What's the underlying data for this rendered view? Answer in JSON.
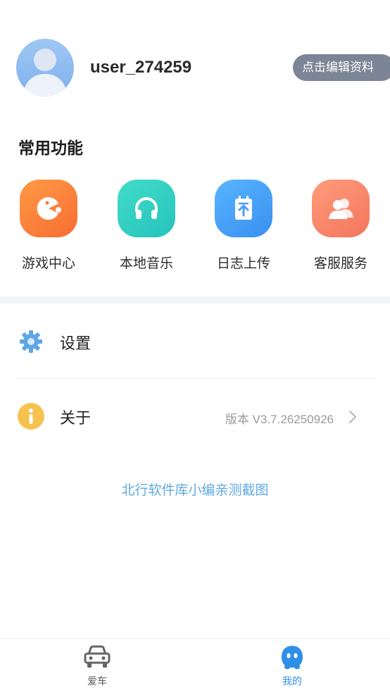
{
  "profile": {
    "username": "user_274259",
    "edit_label": "点击编辑资料"
  },
  "functions": {
    "title": "常用功能",
    "items": [
      {
        "label": "游戏中心",
        "icon": "game-icon",
        "color": "#f7783a"
      },
      {
        "label": "本地音乐",
        "icon": "headphones-icon",
        "color": "#2fcbc0"
      },
      {
        "label": "日志上传",
        "icon": "upload-icon",
        "color": "#4a9ff5"
      },
      {
        "label": "客服服务",
        "icon": "users-icon",
        "color": "#f7826a"
      }
    ]
  },
  "menu": {
    "settings_label": "设置",
    "about_label": "关于",
    "version": "版本 V3.7.26250926"
  },
  "watermark": "北行软件库小编亲测截图",
  "tabbar": {
    "car_label": "爱车",
    "mine_label": "我的",
    "active_color": "#2e8ee8"
  }
}
